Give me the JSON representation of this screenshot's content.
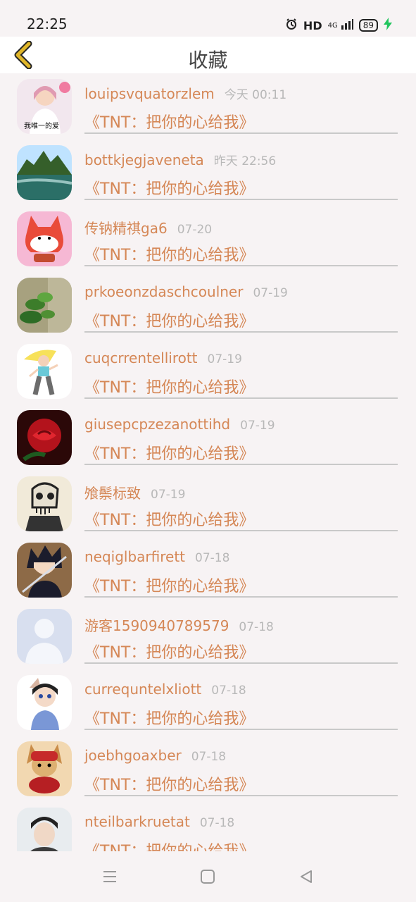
{
  "status": {
    "time": "22:25",
    "hd": "HD",
    "network": "4G",
    "battery": "89",
    "icons": [
      "alarm-icon",
      "signal-icon",
      "battery-icon",
      "charging-icon"
    ]
  },
  "header": {
    "title": "收藏",
    "back_icon": "chevron-left-icon",
    "accent": "#e0b62a"
  },
  "favorites": [
    {
      "name": "louipsvquatorzlem",
      "time": "今天 00:11",
      "work": "《TNT：把你的心给我》",
      "avatar": "girl-photo",
      "avatar_text": "我唯一的爱"
    },
    {
      "name": "bottkjegjaveneta",
      "time": "昨天 22:56",
      "work": "《TNT：把你的心给我》",
      "avatar": "landscape-photo"
    },
    {
      "name": "传钠精祺ga6",
      "time": "07-20",
      "work": "《TNT：把你的心给我》",
      "avatar": "fox-cartoon"
    },
    {
      "name": "prkoeonzdaschcoulner",
      "time": "07-19",
      "work": "《TNT：把你的心给我》",
      "avatar": "plant-photo"
    },
    {
      "name": "cuqcrrentellirott",
      "time": "07-19",
      "work": "《TNT：把你的心给我》",
      "avatar": "girl-cartoon"
    },
    {
      "name": "giusepcpzezanottihd",
      "time": "07-19",
      "work": "《TNT：把你的心给我》",
      "avatar": "rose-photo"
    },
    {
      "name": "飧鬃标致",
      "time": "07-19",
      "work": "《TNT：把你的心给我》",
      "avatar": "skull-drawing"
    },
    {
      "name": "neqiglbarfirett",
      "time": "07-18",
      "work": "《TNT：把你的心给我》",
      "avatar": "anime-boy"
    },
    {
      "name": "游客1590940789579",
      "time": "07-18",
      "work": "《TNT：把你的心给我》",
      "avatar": "default-user"
    },
    {
      "name": "currequntelxliott",
      "time": "07-18",
      "work": "《TNT：把你的心给我》",
      "avatar": "conan-cartoon"
    },
    {
      "name": "joebhgoaxber",
      "time": "07-18",
      "work": "《TNT：把你的心给我》",
      "avatar": "dog-cartoon"
    },
    {
      "name": "nteilbarkruetat",
      "time": "07-18",
      "work": "《TNT：把你的心给我》",
      "avatar": "man-photo"
    }
  ],
  "colors": {
    "name": "#d58756",
    "time": "#b8b8b8",
    "background": "#f7f3f4"
  },
  "navigation": [
    "menu-icon",
    "home-square-icon",
    "back-triangle-icon"
  ]
}
